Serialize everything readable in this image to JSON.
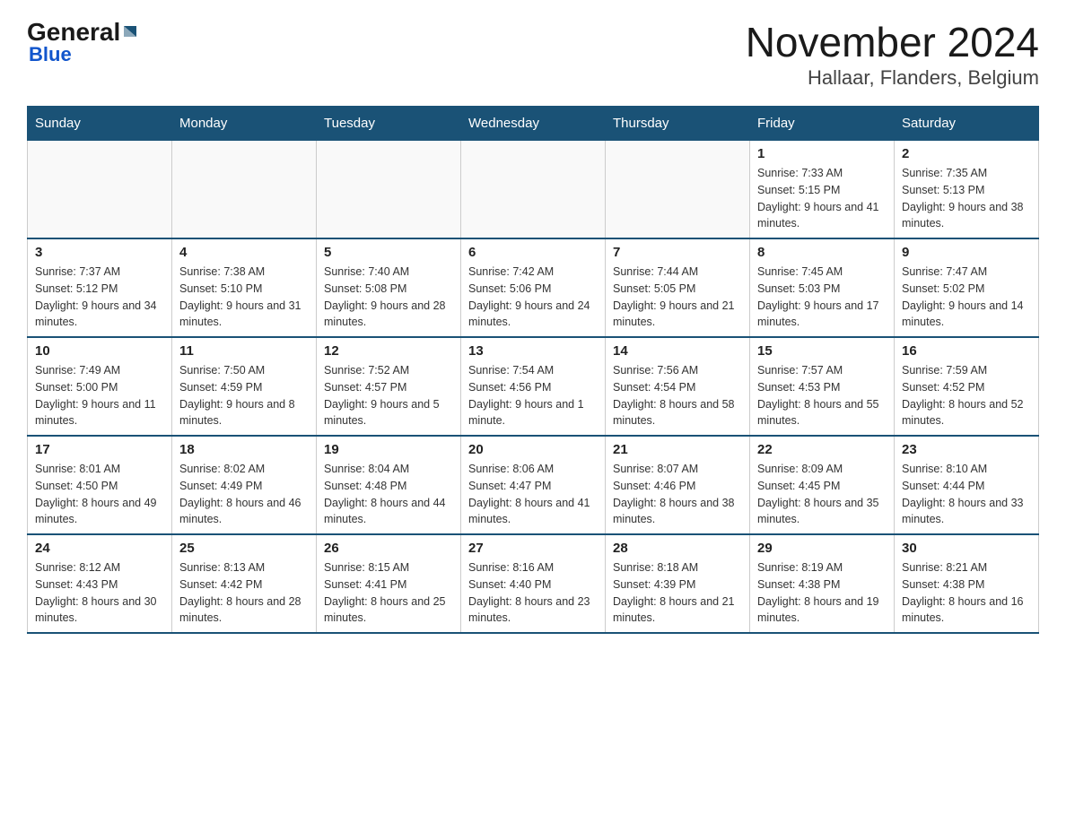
{
  "header": {
    "logo": {
      "general": "General",
      "blue": "Blue"
    },
    "title": "November 2024",
    "subtitle": "Hallaar, Flanders, Belgium"
  },
  "days_of_week": [
    "Sunday",
    "Monday",
    "Tuesday",
    "Wednesday",
    "Thursday",
    "Friday",
    "Saturday"
  ],
  "weeks": [
    [
      {
        "day": "",
        "info": ""
      },
      {
        "day": "",
        "info": ""
      },
      {
        "day": "",
        "info": ""
      },
      {
        "day": "",
        "info": ""
      },
      {
        "day": "",
        "info": ""
      },
      {
        "day": "1",
        "info": "Sunrise: 7:33 AM\nSunset: 5:15 PM\nDaylight: 9 hours and 41 minutes."
      },
      {
        "day": "2",
        "info": "Sunrise: 7:35 AM\nSunset: 5:13 PM\nDaylight: 9 hours and 38 minutes."
      }
    ],
    [
      {
        "day": "3",
        "info": "Sunrise: 7:37 AM\nSunset: 5:12 PM\nDaylight: 9 hours and 34 minutes."
      },
      {
        "day": "4",
        "info": "Sunrise: 7:38 AM\nSunset: 5:10 PM\nDaylight: 9 hours and 31 minutes."
      },
      {
        "day": "5",
        "info": "Sunrise: 7:40 AM\nSunset: 5:08 PM\nDaylight: 9 hours and 28 minutes."
      },
      {
        "day": "6",
        "info": "Sunrise: 7:42 AM\nSunset: 5:06 PM\nDaylight: 9 hours and 24 minutes."
      },
      {
        "day": "7",
        "info": "Sunrise: 7:44 AM\nSunset: 5:05 PM\nDaylight: 9 hours and 21 minutes."
      },
      {
        "day": "8",
        "info": "Sunrise: 7:45 AM\nSunset: 5:03 PM\nDaylight: 9 hours and 17 minutes."
      },
      {
        "day": "9",
        "info": "Sunrise: 7:47 AM\nSunset: 5:02 PM\nDaylight: 9 hours and 14 minutes."
      }
    ],
    [
      {
        "day": "10",
        "info": "Sunrise: 7:49 AM\nSunset: 5:00 PM\nDaylight: 9 hours and 11 minutes."
      },
      {
        "day": "11",
        "info": "Sunrise: 7:50 AM\nSunset: 4:59 PM\nDaylight: 9 hours and 8 minutes."
      },
      {
        "day": "12",
        "info": "Sunrise: 7:52 AM\nSunset: 4:57 PM\nDaylight: 9 hours and 5 minutes."
      },
      {
        "day": "13",
        "info": "Sunrise: 7:54 AM\nSunset: 4:56 PM\nDaylight: 9 hours and 1 minute."
      },
      {
        "day": "14",
        "info": "Sunrise: 7:56 AM\nSunset: 4:54 PM\nDaylight: 8 hours and 58 minutes."
      },
      {
        "day": "15",
        "info": "Sunrise: 7:57 AM\nSunset: 4:53 PM\nDaylight: 8 hours and 55 minutes."
      },
      {
        "day": "16",
        "info": "Sunrise: 7:59 AM\nSunset: 4:52 PM\nDaylight: 8 hours and 52 minutes."
      }
    ],
    [
      {
        "day": "17",
        "info": "Sunrise: 8:01 AM\nSunset: 4:50 PM\nDaylight: 8 hours and 49 minutes."
      },
      {
        "day": "18",
        "info": "Sunrise: 8:02 AM\nSunset: 4:49 PM\nDaylight: 8 hours and 46 minutes."
      },
      {
        "day": "19",
        "info": "Sunrise: 8:04 AM\nSunset: 4:48 PM\nDaylight: 8 hours and 44 minutes."
      },
      {
        "day": "20",
        "info": "Sunrise: 8:06 AM\nSunset: 4:47 PM\nDaylight: 8 hours and 41 minutes."
      },
      {
        "day": "21",
        "info": "Sunrise: 8:07 AM\nSunset: 4:46 PM\nDaylight: 8 hours and 38 minutes."
      },
      {
        "day": "22",
        "info": "Sunrise: 8:09 AM\nSunset: 4:45 PM\nDaylight: 8 hours and 35 minutes."
      },
      {
        "day": "23",
        "info": "Sunrise: 8:10 AM\nSunset: 4:44 PM\nDaylight: 8 hours and 33 minutes."
      }
    ],
    [
      {
        "day": "24",
        "info": "Sunrise: 8:12 AM\nSunset: 4:43 PM\nDaylight: 8 hours and 30 minutes."
      },
      {
        "day": "25",
        "info": "Sunrise: 8:13 AM\nSunset: 4:42 PM\nDaylight: 8 hours and 28 minutes."
      },
      {
        "day": "26",
        "info": "Sunrise: 8:15 AM\nSunset: 4:41 PM\nDaylight: 8 hours and 25 minutes."
      },
      {
        "day": "27",
        "info": "Sunrise: 8:16 AM\nSunset: 4:40 PM\nDaylight: 8 hours and 23 minutes."
      },
      {
        "day": "28",
        "info": "Sunrise: 8:18 AM\nSunset: 4:39 PM\nDaylight: 8 hours and 21 minutes."
      },
      {
        "day": "29",
        "info": "Sunrise: 8:19 AM\nSunset: 4:38 PM\nDaylight: 8 hours and 19 minutes."
      },
      {
        "day": "30",
        "info": "Sunrise: 8:21 AM\nSunset: 4:38 PM\nDaylight: 8 hours and 16 minutes."
      }
    ]
  ]
}
